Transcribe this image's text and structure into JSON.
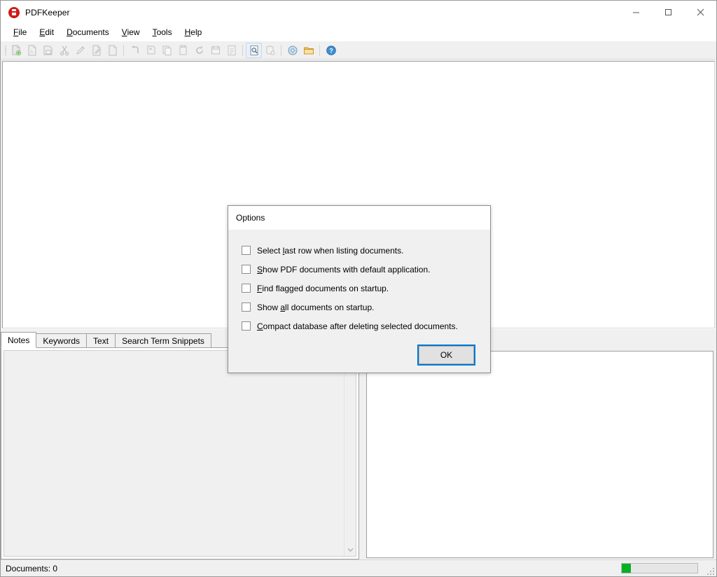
{
  "window": {
    "title": "PDFKeeper",
    "app_icon": "pdfkeeper-icon",
    "controls": {
      "minimize": "minimize-icon",
      "maximize": "maximize-icon",
      "close": "close-icon"
    }
  },
  "menubar": {
    "items": [
      {
        "label": "File",
        "mnemonic": "F",
        "rest": "ile"
      },
      {
        "label": "Edit",
        "mnemonic": "E",
        "rest": "dit"
      },
      {
        "label": "Documents",
        "mnemonic": "D",
        "rest": "ocuments"
      },
      {
        "label": "View",
        "mnemonic": "V",
        "rest": "iew"
      },
      {
        "label": "Tools",
        "mnemonic": "T",
        "rest": "ools"
      },
      {
        "label": "Help",
        "mnemonic": "H",
        "rest": "elp"
      }
    ]
  },
  "toolbar": {
    "groups": [
      {
        "buttons": [
          {
            "icon": "add-document-icon",
            "enabled": false
          },
          {
            "icon": "open-pdf-icon",
            "enabled": false
          },
          {
            "icon": "save-document-icon",
            "enabled": false
          },
          {
            "icon": "cut-icon",
            "enabled": false
          },
          {
            "icon": "edit-pencil-icon",
            "enabled": false
          },
          {
            "icon": "edit-document-icon",
            "enabled": false
          },
          {
            "icon": "lock-document-icon",
            "enabled": false
          }
        ]
      },
      {
        "buttons": [
          {
            "icon": "undo-icon",
            "enabled": false
          },
          {
            "icon": "redo-icon",
            "enabled": false
          },
          {
            "icon": "copy-icon",
            "enabled": false
          },
          {
            "icon": "paste-icon",
            "enabled": false
          },
          {
            "icon": "refresh-icon",
            "enabled": false
          },
          {
            "icon": "calendar-flag-icon",
            "enabled": false
          },
          {
            "icon": "text-document-icon",
            "enabled": false
          }
        ]
      },
      {
        "buttons": [
          {
            "icon": "search-document-icon",
            "enabled": true
          },
          {
            "icon": "database-search-icon",
            "enabled": false
          }
        ]
      },
      {
        "buttons": [
          {
            "icon": "deploy-icon",
            "enabled": true
          },
          {
            "icon": "folder-icon",
            "enabled": true
          }
        ]
      },
      {
        "buttons": [
          {
            "icon": "help-icon",
            "enabled": true
          }
        ]
      }
    ]
  },
  "document_list": {
    "name": "document-list",
    "rows": []
  },
  "tabs": {
    "items": [
      {
        "label": "Notes",
        "selected": true
      },
      {
        "label": "Keywords",
        "selected": false
      },
      {
        "label": "Text",
        "selected": false
      },
      {
        "label": "Search Term Snippets",
        "selected": false
      }
    ]
  },
  "notes": {
    "value": "",
    "placeholder": ""
  },
  "preview": {
    "name": "document-preview"
  },
  "statusbar": {
    "documents_label": "Documents:",
    "documents_count": "0",
    "documents_text": "Documents:  0",
    "progress_percent": 12,
    "progress_color": "#06b025"
  },
  "dialog": {
    "title": "Options",
    "checkboxes": [
      {
        "pre": "Select ",
        "mnemonic": "l",
        "post": "ast row when listing documents.",
        "checked": false,
        "name": "select-last-row-checkbox"
      },
      {
        "pre": "",
        "mnemonic": "S",
        "post": "how PDF documents with default application.",
        "checked": false,
        "name": "show-pdf-default-app-checkbox"
      },
      {
        "pre": "",
        "mnemonic": "F",
        "post": "ind flagged documents on startup.",
        "checked": false,
        "name": "find-flagged-startup-checkbox"
      },
      {
        "pre": "Show ",
        "mnemonic": "a",
        "post": "ll documents on startup.",
        "checked": false,
        "name": "show-all-startup-checkbox"
      },
      {
        "pre": "",
        "mnemonic": "C",
        "post": "ompact database after deleting selected documents.",
        "checked": false,
        "name": "compact-database-checkbox"
      }
    ],
    "ok_label": "OK"
  }
}
